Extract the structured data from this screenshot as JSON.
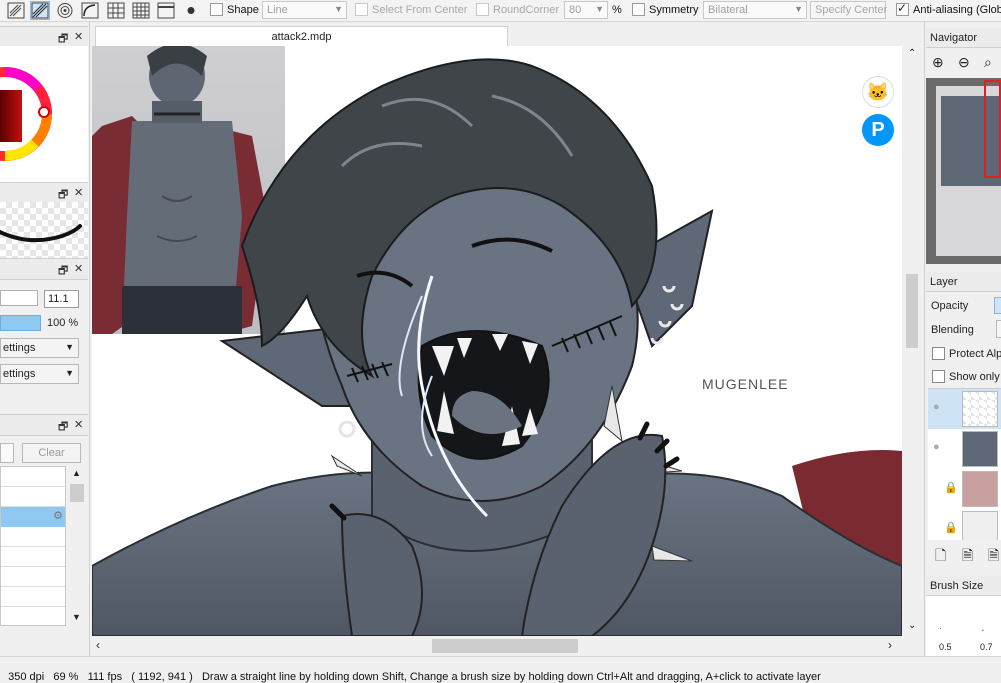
{
  "toolbar": {
    "tools": [
      {
        "name": "pattern-hatch-icon"
      },
      {
        "name": "parallel-lines-icon",
        "active": true
      },
      {
        "name": "concentric-circles-icon"
      },
      {
        "name": "curve-ruler-icon"
      },
      {
        "name": "grid-icon"
      },
      {
        "name": "perspective-grid-icon"
      },
      {
        "name": "window-icon"
      },
      {
        "name": "dot-icon"
      }
    ],
    "shape_label": "Shape",
    "shape_value": "Line",
    "select_from_center_label": "Select From Center",
    "round_corner_label": "RoundCorner",
    "round_corner_value": "80",
    "percent_unit": "%",
    "symmetry_label": "Symmetry",
    "symmetry_value": "Bilateral",
    "specify_center_label": "Specify Center",
    "anti_aliasing_label": "Anti-aliasing (Global"
  },
  "left": {
    "brush_size_value": "11.1",
    "opacity_value": "100 %",
    "settings_1": "ettings",
    "settings_2": "ettings",
    "clear_label": "Clear"
  },
  "canvas": {
    "tab_title": "attack2.mdp",
    "signature": "MUGENLEE"
  },
  "navigator": {
    "title": "Navigator"
  },
  "layer": {
    "title": "Layer",
    "opacity_label": "Opacity",
    "blending_label": "Blending",
    "protect_alpha_label": "Protect Alp",
    "show_only_label": "Show only"
  },
  "brush_size_panel": {
    "title": "Brush Size",
    "sizes": [
      "0.5",
      "0.7"
    ]
  },
  "status": {
    "text": "350 dpi   69 %   111 fps   ( 1192, 941 )   Draw a straight line by holding down Shift, Change a brush size by holding down Ctrl+Alt and dragging, A+click to activate layer"
  },
  "colors": {
    "accent": "#4ea6e8",
    "selection": "#cfe3f7",
    "pixiv": "#0096fa",
    "skin": "#5f6877",
    "hair": "#3e4447",
    "jacket": "#7a2a30"
  }
}
